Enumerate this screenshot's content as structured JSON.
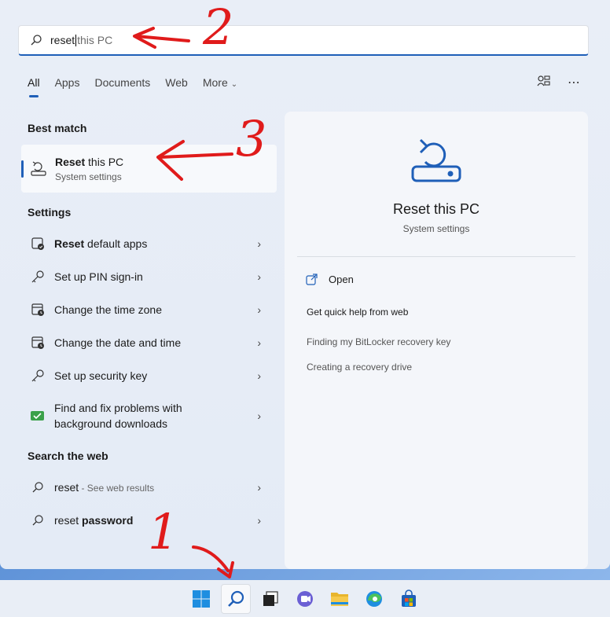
{
  "search": {
    "typed": "reset",
    "suggestion": " this PC"
  },
  "tabs": [
    {
      "label": "All"
    },
    {
      "label": "Apps"
    },
    {
      "label": "Documents"
    },
    {
      "label": "Web"
    },
    {
      "label": "More"
    }
  ],
  "sections": {
    "best_match": "Best match",
    "settings": "Settings",
    "search_web": "Search the web"
  },
  "best_match": {
    "title_bold": "Reset",
    "title_rest": " this PC",
    "subtitle": "System settings"
  },
  "settings_items": [
    {
      "bold": "Reset",
      "rest": " default apps",
      "icon": "default-apps-icon"
    },
    {
      "bold": "",
      "rest": "Set up PIN sign-in",
      "icon": "key-icon"
    },
    {
      "bold": "",
      "rest": "Change the time zone",
      "icon": "clock-icon"
    },
    {
      "bold": "",
      "rest": "Change the date and time",
      "icon": "calendar-clock-icon"
    },
    {
      "bold": "",
      "rest": "Set up security key",
      "icon": "key-icon"
    },
    {
      "bold": "",
      "rest": "Find and fix problems with background downloads",
      "line1": "Find and fix problems with",
      "line2": "background downloads",
      "icon": "troubleshoot-icon"
    }
  ],
  "web_items": [
    {
      "text": "reset",
      "suffix": " - See web results"
    },
    {
      "text": "reset ",
      "bold": "password"
    }
  ],
  "preview": {
    "title": "Reset this PC",
    "subtitle": "System settings",
    "open": "Open",
    "help_heading": "Get quick help from web",
    "links": [
      "Finding my BitLocker recovery key",
      "Creating a recovery drive"
    ]
  },
  "annotations": [
    "2",
    "3",
    "1"
  ],
  "colors": {
    "accent": "#1f5fb8",
    "annotation": "#e01b1b"
  }
}
